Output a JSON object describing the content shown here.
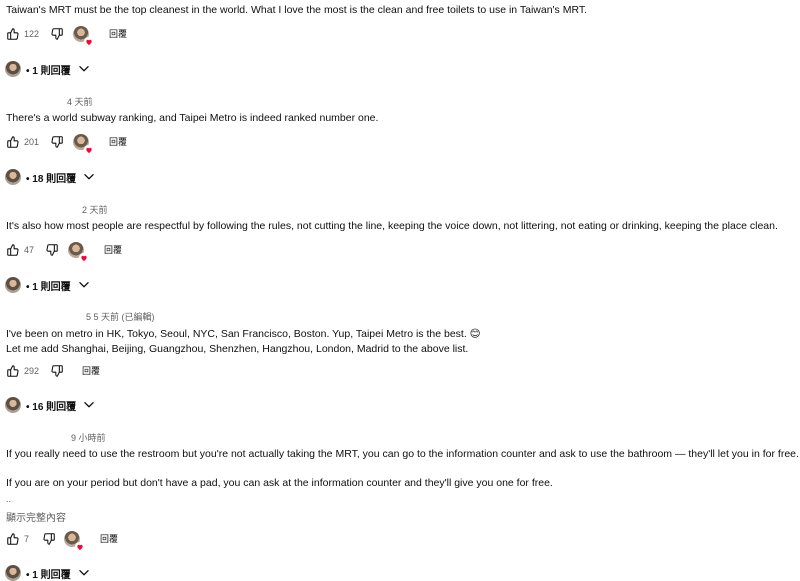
{
  "comments": [
    {
      "text_lines": [
        "Taiwan's MRT must be the top cleanest in the world. What I love the most is the clean and free toilets to use in Taiwan's MRT."
      ],
      "likes": "122",
      "reply_label": "回覆",
      "replies_label": "• 1 則回覆"
    },
    {
      "time": "4 天前",
      "text_lines": [
        "There's a world subway ranking, and Taipei Metro is indeed ranked number one."
      ],
      "likes": "201",
      "reply_label": "回覆",
      "replies_label": "• 18 則回覆"
    },
    {
      "time": "2 天前",
      "text_lines": [
        "It's also how most people are respectful by following the rules, not cutting the line, keeping the voice down, not littering, not eating or drinking, keeping the place clean."
      ],
      "likes": "47",
      "reply_label": "回覆",
      "replies_label": "• 1 則回覆"
    },
    {
      "time": "5 5 天前 (已編輯)",
      "text_lines": [
        "I've been on metro in HK, Tokyo, Seoul, NYC, San Francisco, Boston. Yup, Taipei Metro is the best. 😊",
        "Let me add Shanghai, Beijing, Guangzhou, Shenzhen, Hangzhou, London, Madrid to the above list."
      ],
      "likes": "292",
      "reply_label": "回覆",
      "replies_label": "• 16 則回覆"
    },
    {
      "time": "9 小時前",
      "text_lines": [
        "If you really need to use the restroom but you're not actually taking the MRT, you can go to the information counter and ask to use the bathroom — they'll let you in for free.",
        "",
        "If you are on your period but don't have a pad, you can ask at the information counter and they'll give you one for free.",
        ".."
      ],
      "show_more": "顯示完整內容",
      "likes": "7",
      "reply_label": "回覆",
      "replies_label": "• 1 則回覆"
    }
  ],
  "icons": {
    "like": "thumbs-up-icon",
    "dislike": "thumbs-down-icon",
    "creator_heart": "creator-heart-icon",
    "expand": "chevron-down-icon"
  },
  "colors": {
    "heart": "#ff0033",
    "meta_text": "#606060"
  }
}
